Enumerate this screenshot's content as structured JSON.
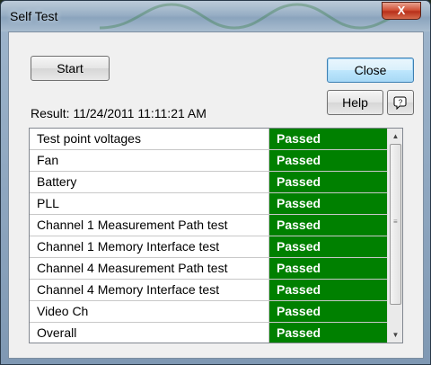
{
  "window": {
    "title": "Self Test",
    "close_glyph": "X"
  },
  "buttons": {
    "start": "Start",
    "close": "Close",
    "help": "Help",
    "help_icon": "question-icon"
  },
  "result": {
    "text": "Result: 11/24/2011 11:11:21 AM"
  },
  "tests": [
    {
      "name": "Test point voltages",
      "status": "Passed"
    },
    {
      "name": "Fan",
      "status": "Passed"
    },
    {
      "name": "Battery",
      "status": "Passed"
    },
    {
      "name": "PLL",
      "status": "Passed"
    },
    {
      "name": "Channel 1 Measurement Path test",
      "status": "Passed"
    },
    {
      "name": "Channel 1 Memory Interface test",
      "status": "Passed"
    },
    {
      "name": "Channel 4 Measurement Path test",
      "status": "Passed"
    },
    {
      "name": "Channel 4 Memory Interface test",
      "status": "Passed"
    },
    {
      "name": "Video Ch",
      "status": "Passed"
    },
    {
      "name": "Overall",
      "status": "Passed"
    }
  ],
  "colors": {
    "passed_bg": "#008000",
    "passed_text": "#ffffff"
  }
}
